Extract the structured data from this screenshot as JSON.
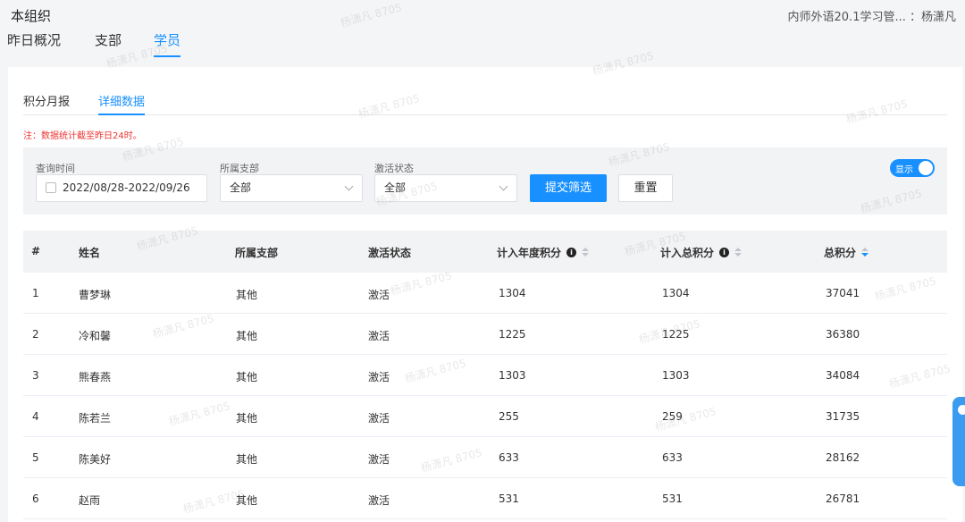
{
  "topbar": {
    "title": "本组织",
    "right_text": "内师外语20.1学习管...  ：杨潇凡"
  },
  "subnav": {
    "tabs": [
      "昨日概况",
      "支部",
      "学员"
    ]
  },
  "tabs": [
    "积分月报",
    "详细数据"
  ],
  "note": "注：数据统计截至昨日24时。",
  "filters": {
    "date_label": "查询时间",
    "date_value": "2022/08/28-2022/09/26",
    "branch_label": "所属支部",
    "branch_value": "全部",
    "status_label": "激活状态",
    "status_value": "全部",
    "submit_label": "提交筛选",
    "reset_label": "重置",
    "toggle_label": "显示"
  },
  "table": {
    "headers": [
      "#",
      "姓名",
      "所属支部",
      "激活状态",
      "计入年度积分",
      "计入总积分",
      "总积分"
    ],
    "rows": [
      [
        "1",
        "曹梦琳",
        "其他",
        "激活",
        "1304",
        "1304",
        "37041"
      ],
      [
        "2",
        "冷和馨",
        "其他",
        "激活",
        "1225",
        "1225",
        "36380"
      ],
      [
        "3",
        "熊春燕",
        "其他",
        "激活",
        "1303",
        "1303",
        "34084"
      ],
      [
        "4",
        "陈若兰",
        "其他",
        "激活",
        "255",
        "259",
        "31735"
      ],
      [
        "5",
        "陈美好",
        "其他",
        "激活",
        "633",
        "633",
        "28162"
      ],
      [
        "6",
        "赵雨",
        "其他",
        "激活",
        "531",
        "531",
        "26781"
      ]
    ]
  },
  "watermark": "杨潇凡 8705",
  "colors": {
    "accent": "#1890ff",
    "note": "#ee3333"
  }
}
